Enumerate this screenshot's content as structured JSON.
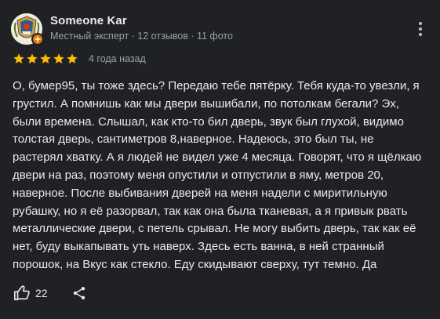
{
  "author": {
    "name": "Someone Kar",
    "meta": "Местный эксперт · 12 отзывов · 11 фото",
    "avatar_icon": "avatar-emblem-icon",
    "badge_icon": "local-guide-badge-icon",
    "badge_color": "#e37400"
  },
  "review": {
    "rating": 5,
    "rating_max": 5,
    "star_color": "#fbbc04",
    "date": "4 года назад",
    "text": "О, бумер95, ты тоже здесь? Передаю тебе пятёрку. Тебя куда-то увезли, я\nгрустил. А помнишь как мы двери вышибали, по потолкам бегали? Эх,\nбыли времена. Слышал, как кто-то бил дверь, звук был глухой, видимо\nтолстая дверь, сантиметров 8,наверное. Надеюсь, это был ты, не\nрастерял хватку. А я людей не видел уже 4 месяца. Говорят, что я щёлкаю\nдвери на раз, поэтому меня опустили и отпустили в яму, метров 20,\nнаверное. После выбивания дверей на меня надели с миритильную\nрубашку, но я её разорвал, так как она была тканевая, а я привык рвать\nметаллические двери, с петель срывал. Не могу выбить дверь, так как её\nнет, буду выкапывать уть наверх. Здесь есть ванна, в ней странный\nпорошок, на Вкус как стекло. Еду скидывают сверху, тут темно. Да"
  },
  "actions": {
    "like_icon": "thumbs-up-icon",
    "like_count": "22",
    "share_icon": "share-icon",
    "more_icon": "more-vertical-icon"
  },
  "colors": {
    "background": "#202124",
    "text_primary": "#e8eaed",
    "text_secondary": "#9aa0a6"
  }
}
